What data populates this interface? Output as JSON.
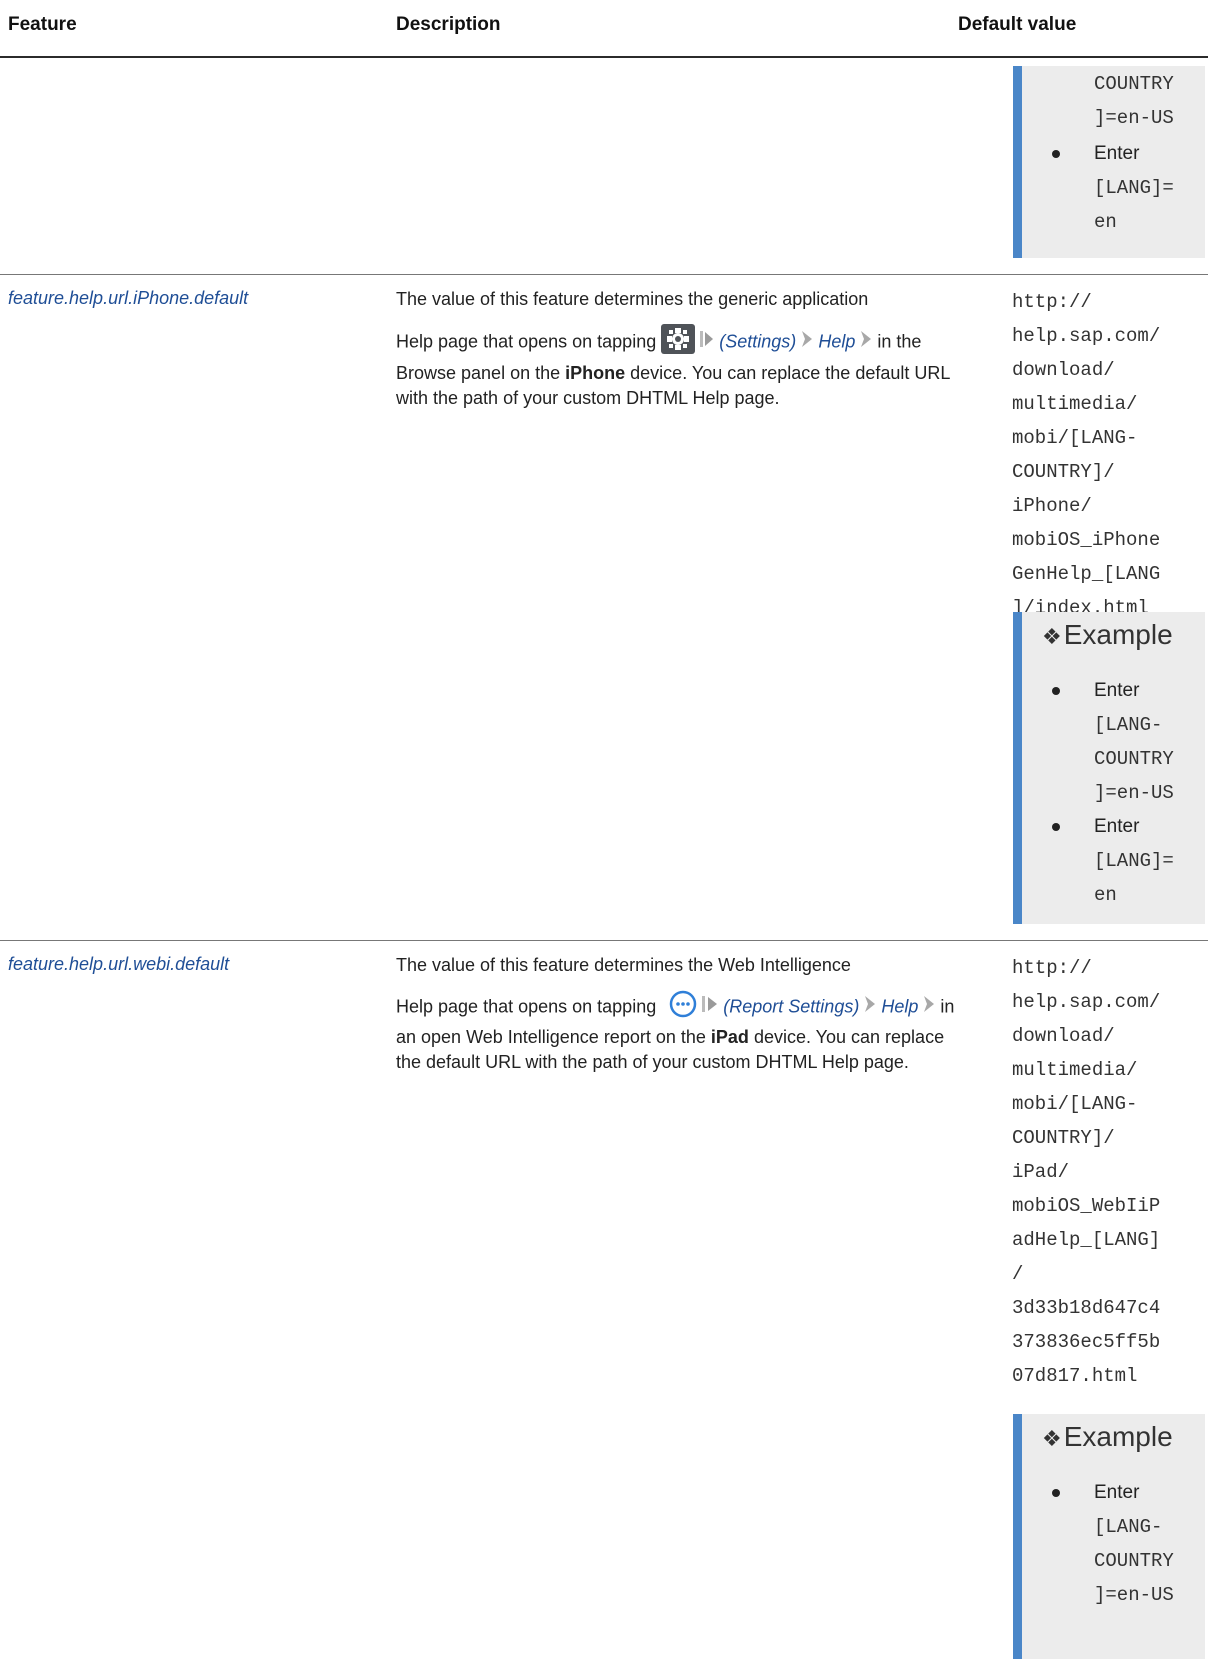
{
  "header": {
    "feature": "Feature",
    "description": "Description",
    "default_value": "Default value"
  },
  "top_example": {
    "lines": [
      "COUNTRY",
      "]=en-US"
    ],
    "item2_label": "Enter",
    "item2_lines": [
      "[LANG]=",
      "en"
    ]
  },
  "rows": [
    {
      "feature": "feature.help.url.iPhone.default",
      "desc_lead": "The value of this feature determines the generic application",
      "desc_tap": "Help page that opens on tapping",
      "settings_label": "(Settings)",
      "help_label": "Help",
      "desc_p1": "in the Browse panel on the",
      "device": "iPhone",
      "desc_p2": "device. You can replace the default URL with the path of your custom DHTML Help page.",
      "default_lines": [
        "http://",
        "help.sap.com/",
        "download/",
        "multimedia/",
        "mobi/[LANG-",
        "COUNTRY]/",
        "iPhone/",
        "mobiOS_iPhone",
        "GenHelp_[LANG",
        "]/index.html"
      ],
      "example": {
        "title": "Example",
        "item1_label": "Enter",
        "item1_lines": [
          "[LANG-",
          "COUNTRY",
          "]=en-US"
        ],
        "item2_label": "Enter",
        "item2_lines": [
          "[LANG]=",
          "en"
        ]
      }
    },
    {
      "feature": "feature.help.url.webi.default",
      "desc_lead": "The value of this feature determines the Web Intelligence",
      "desc_tap": "Help page that opens on tapping",
      "settings_label": "(Report Settings)",
      "help_label": "Help",
      "desc_p1": "in an open Web Intelligence report on the",
      "device": "iPad",
      "desc_p2": "device. You can replace the default URL with the path of your custom DHTML Help page.",
      "default_lines": [
        "http://",
        "help.sap.com/",
        "download/",
        "multimedia/",
        "mobi/[LANG-",
        "COUNTRY]/",
        "iPad/",
        "mobiOS_WebIiP",
        "adHelp_[LANG]",
        "/",
        "3d33b18d647c4",
        "373836ec5ff5b",
        "07d817.html"
      ],
      "example": {
        "title": "Example",
        "item1_label": "Enter",
        "item1_lines": [
          "[LANG-",
          "COUNTRY",
          "]=en-US"
        ]
      }
    }
  ],
  "colors": {
    "link": "#1f4e96",
    "example_bar": "#4a86c8",
    "example_bg": "#ececec"
  },
  "icons": [
    "gear-icon",
    "more-icon",
    "menu-arrow-icon",
    "chevron-right-icon"
  ]
}
